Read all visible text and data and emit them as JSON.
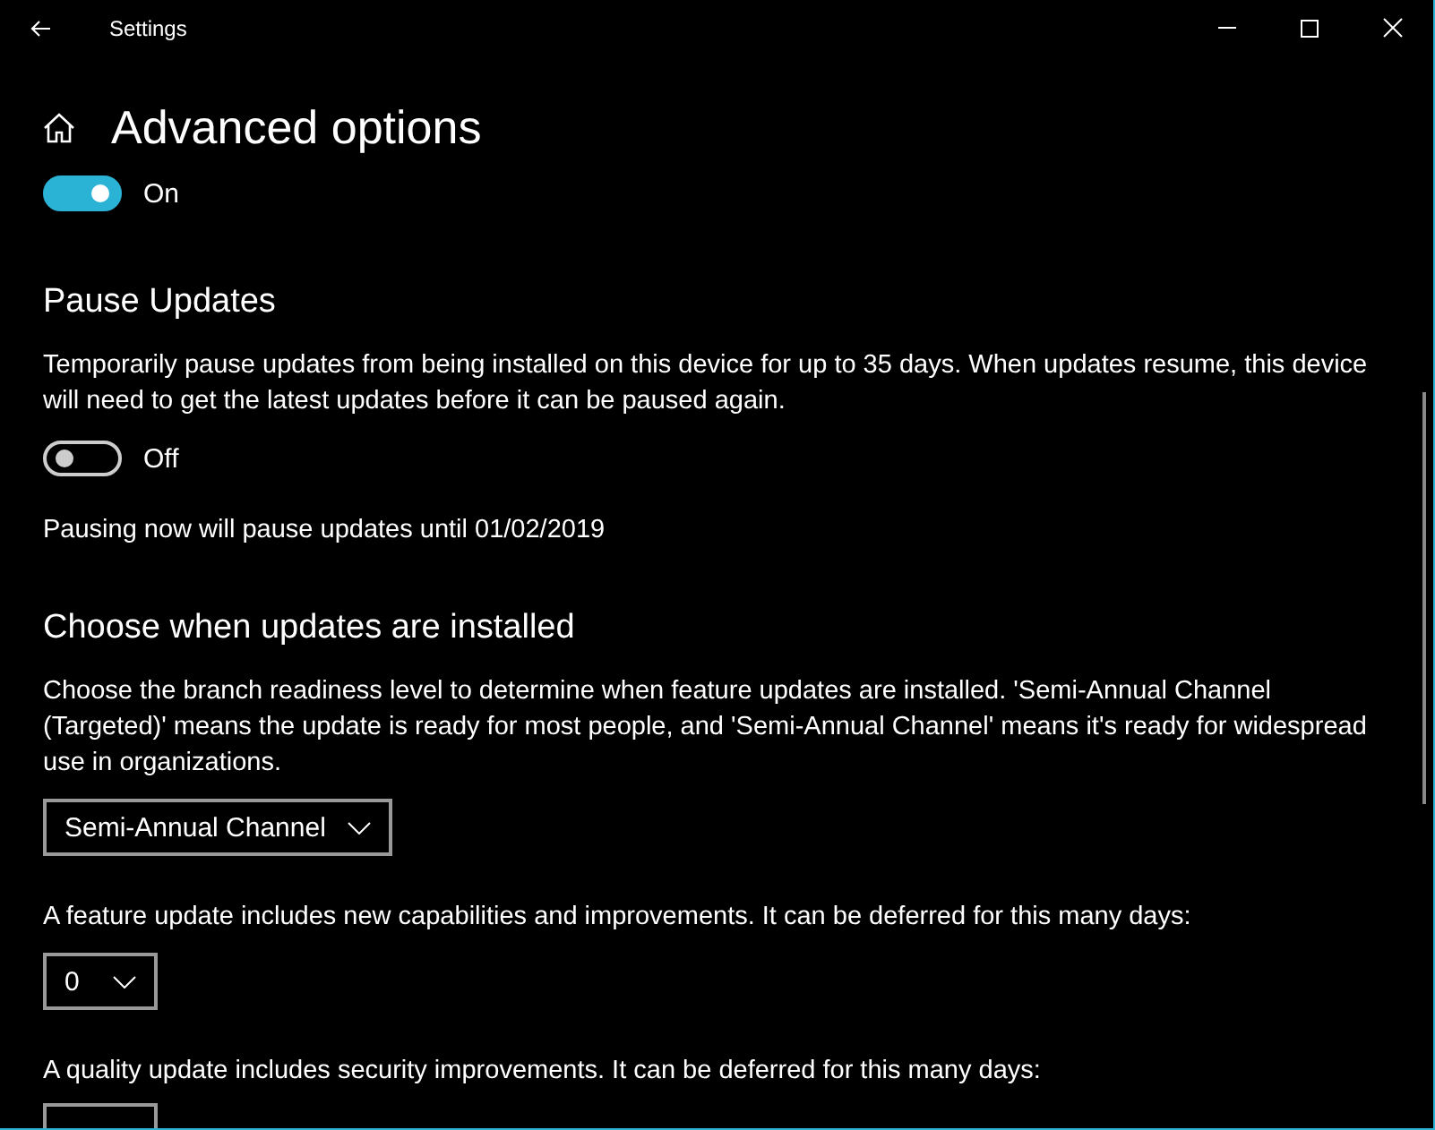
{
  "window": {
    "title": "Settings"
  },
  "page": {
    "title": "Advanced options"
  },
  "items": [
    {
      "kind": "toggle",
      "on": true,
      "label": "On"
    },
    {
      "kind": "heading",
      "text": "Pause Updates"
    },
    {
      "kind": "paragraph",
      "text": "Temporarily pause updates from being installed on this device for up to 35 days. When updates resume, this device will need to get the latest updates before it can be paused again."
    },
    {
      "kind": "toggle",
      "on": false,
      "label": "Off"
    },
    {
      "kind": "paragraph",
      "text": "Pausing now will pause updates until 01/02/2019"
    },
    {
      "kind": "heading",
      "text": "Choose when updates are installed"
    },
    {
      "kind": "paragraph",
      "text": "Choose the branch readiness level to determine when feature updates are installed. 'Semi-Annual Channel (Targeted)' means the update is ready for most people, and 'Semi-Annual Channel' means it's ready for widespread use in organizations."
    },
    {
      "kind": "dropdown",
      "value": "Semi-Annual Channel"
    },
    {
      "kind": "paragraph",
      "text": "A feature update includes new capabilities and improvements. It can be deferred for this many days:"
    },
    {
      "kind": "dropdown",
      "value": "0"
    },
    {
      "kind": "paragraph",
      "text": "A quality update includes security improvements. It can be deferred for this many days:"
    },
    {
      "kind": "dropdown"
    }
  ]
}
